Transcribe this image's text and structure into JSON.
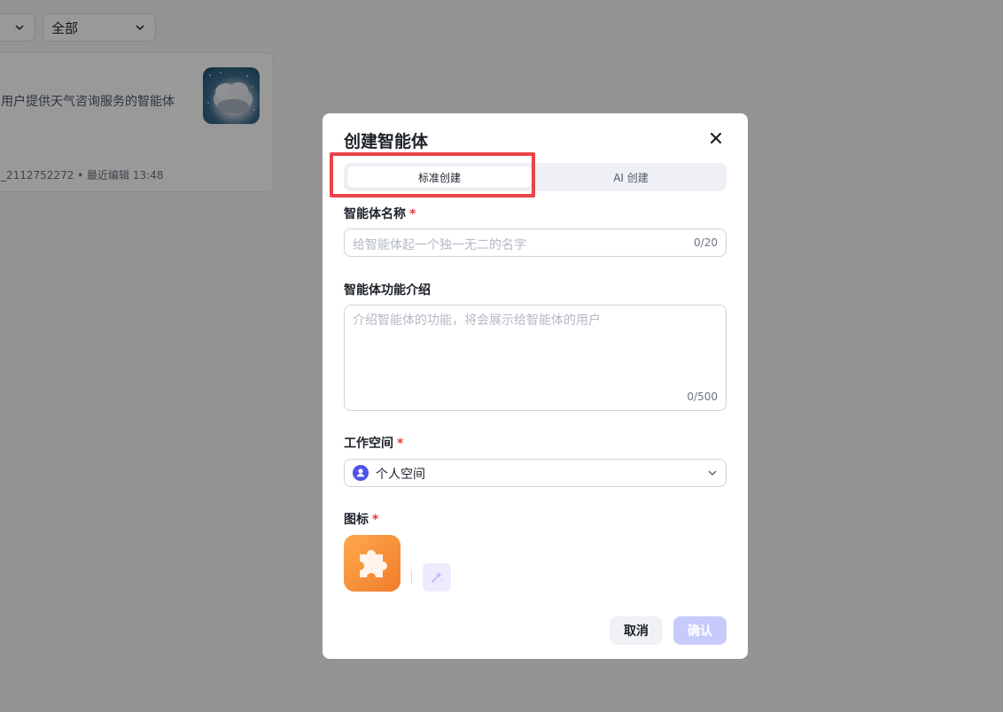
{
  "background": {
    "filter_value": "全部",
    "card_desc": "用户提供天气咨询服务的智能体",
    "card_meta": "_2112752272 • 最近编辑 13:48"
  },
  "modal": {
    "title": "创建智能体",
    "tabs": [
      {
        "label": "标准创建",
        "active": true
      },
      {
        "label": "AI 创建",
        "active": false
      }
    ],
    "name_label": "智能体名称",
    "name_placeholder": "给智能体起一个独一无二的名字",
    "name_count": "0/20",
    "desc_label": "智能体功能介绍",
    "desc_placeholder": "介绍智能体的功能，将会展示给智能体的用户",
    "desc_count": "0/500",
    "workspace_label": "工作空间",
    "workspace_value": "个人空间",
    "icon_label": "图标",
    "required_mark": "*",
    "cancel_label": "取消",
    "confirm_label": "确认"
  },
  "colors": {
    "accent": "#4d53e8",
    "highlight": "#e8444a",
    "icon_tile": "#f07c2a"
  }
}
